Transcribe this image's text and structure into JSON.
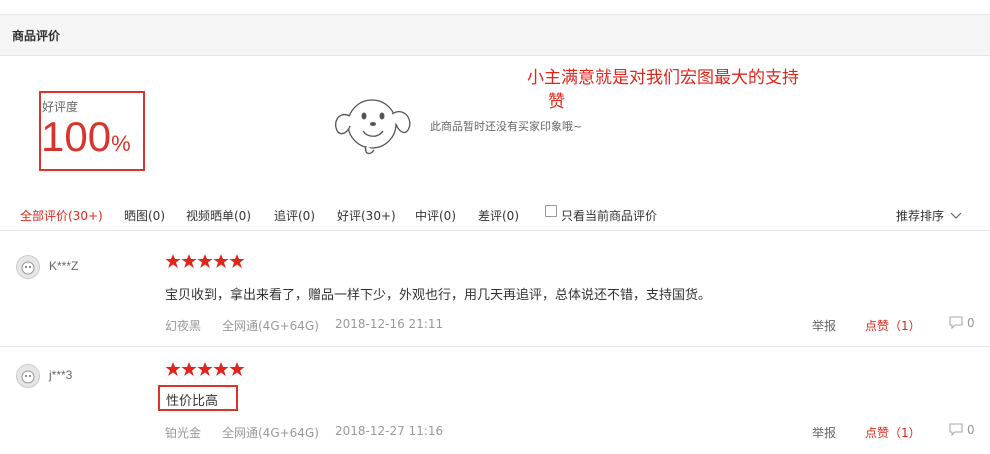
{
  "section": {
    "title": "商品评价"
  },
  "rating": {
    "label": "好评度",
    "value": "100",
    "unit": "%"
  },
  "empty": {
    "tip": "此商品暂时还没有买家印象哦~"
  },
  "promo": {
    "line1": "小主满意就是对我们宏图最大的支持",
    "line2": "赞"
  },
  "tabs": [
    {
      "label": "全部评价(30+)",
      "active": true
    },
    {
      "label": "晒图(0)"
    },
    {
      "label": "视频晒单(0)"
    },
    {
      "label": "追评(0)"
    },
    {
      "label": "好评(30+)"
    },
    {
      "label": "中评(0)"
    },
    {
      "label": "差评(0)"
    }
  ],
  "filter": {
    "current_only_label": "只看当前商品评价",
    "checked": false
  },
  "sort": {
    "label": "推荐排序"
  },
  "reviews": [
    {
      "user": "K***Z",
      "stars": 5,
      "content": "宝贝收到，拿出来看了，赠品一样下少，外观也行，用几天再追评，总体说还不错，支持国货。",
      "color": "幻夜黑",
      "spec": "全网通(4G+64G)",
      "date": "2018-12-16 21:11",
      "report": "举报",
      "like": "点赞（1）",
      "comments": "0"
    },
    {
      "user": "j***3",
      "stars": 5,
      "content": "性价比高",
      "color": "铂光金",
      "spec": "全网通(4G+64G)",
      "date": "2018-12-27 11:16",
      "report": "举报",
      "like": "点赞（1）",
      "comments": "0"
    }
  ],
  "colors": {
    "accent": "#e1251b",
    "highlight_box": "#d9342b"
  }
}
